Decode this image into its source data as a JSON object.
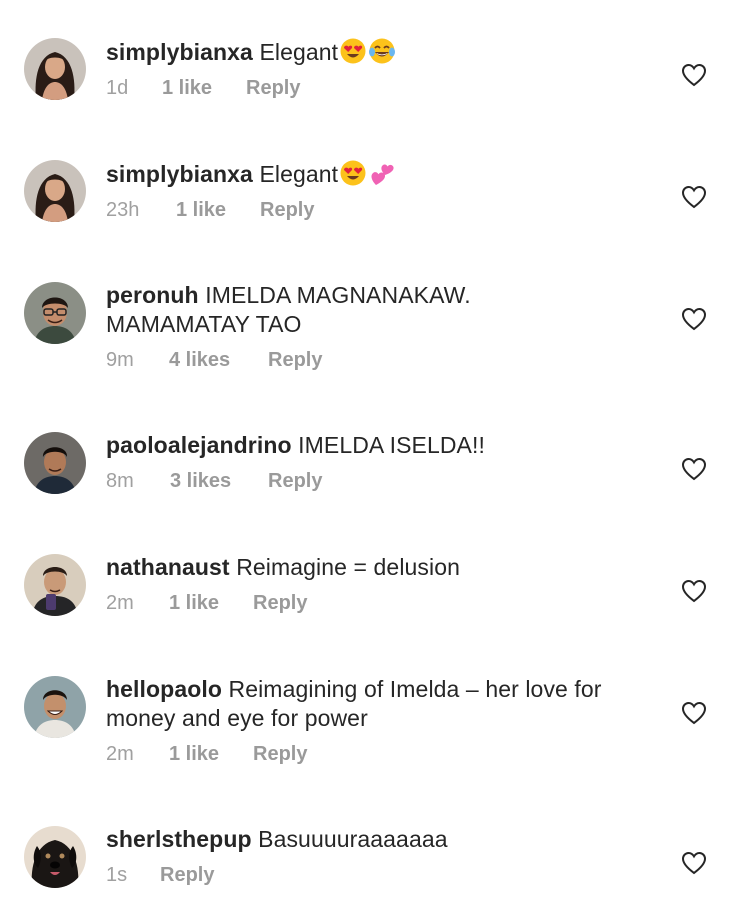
{
  "comments": [
    {
      "username": "simplybianxa",
      "text": "Elegant",
      "emojis": [
        "heart-eyes-emoji",
        "tears-of-joy-emoji"
      ],
      "time": "1d",
      "likes": "1 like",
      "reply": "Reply",
      "avatar": "woman-long-hair-avatar"
    },
    {
      "username": "simplybianxa",
      "text": "Elegant",
      "emojis": [
        "heart-eyes-emoji",
        "two-hearts-emoji"
      ],
      "time": "23h",
      "likes": "1 like",
      "reply": "Reply",
      "avatar": "woman-long-hair-avatar"
    },
    {
      "username": "peronuh",
      "text": "IMELDA MAGNANAKAW.",
      "text2": "MAMAMATAY TAO",
      "time": "9m",
      "likes": "4 likes",
      "reply": "Reply",
      "avatar": "man-glasses-avatar"
    },
    {
      "username": "paoloalejandrino",
      "text": "IMELDA ISELDA!!",
      "time": "8m",
      "likes": "3 likes",
      "reply": "Reply",
      "avatar": "man-dark-hair-avatar"
    },
    {
      "username": "nathanaust",
      "text": "Reimagine = delusion",
      "time": "2m",
      "likes": "1 like",
      "reply": "Reply",
      "avatar": "man-selfie-avatar"
    },
    {
      "username": "hellopaolo",
      "text": "Reimagining of Imelda – her love for",
      "text2": "money and eye for power",
      "time": "2m",
      "likes": "1 like",
      "reply": "Reply",
      "avatar": "man-smiling-avatar"
    },
    {
      "username": "sherlsthepup",
      "text": "Basuuuuraaaaaaa",
      "time": "1s",
      "likes": "",
      "reply": "Reply",
      "avatar": "black-dog-avatar"
    }
  ],
  "colors": {
    "text": "#262626",
    "meta": "#8e8e8e",
    "heart_outline": "#262626"
  }
}
